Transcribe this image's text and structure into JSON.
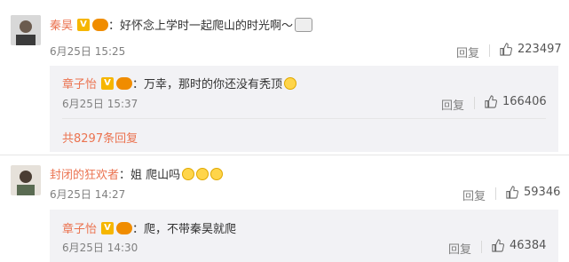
{
  "comments": [
    {
      "user": "秦昊",
      "colon": "：",
      "text": "好怀念上学时一起爬山的时光啊～",
      "time": "6月25日 15:25",
      "reply_label": "回复",
      "likes": "223497",
      "replies": [
        {
          "user": "章子怡",
          "colon": "：",
          "text": "万幸，那时的你还没有秃顶",
          "time": "6月25日 15:37",
          "reply_label": "回复",
          "likes": "166406"
        }
      ],
      "more_replies": "共8297条回复"
    },
    {
      "user": "封闭的狂欢者",
      "colon": "：",
      "text": "姐 爬山吗",
      "time": "6月25日 14:27",
      "reply_label": "回复",
      "likes": "59346",
      "replies": [
        {
          "user": "章子怡",
          "colon": "：",
          "text": "爬，不带秦昊就爬",
          "time": "6月25日 14:30",
          "reply_label": "回复",
          "likes": "46384"
        }
      ]
    }
  ],
  "badges": {
    "verified": "V"
  },
  "colors": {
    "accent": "#eb7350",
    "muted": "#808080",
    "reply_bg": "#f2f2f5"
  }
}
